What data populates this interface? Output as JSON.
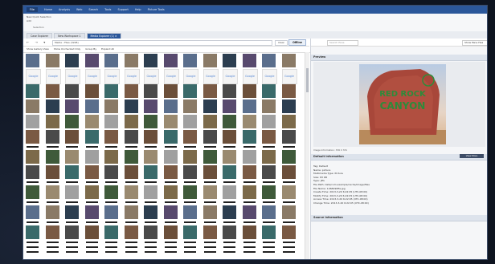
{
  "menubar": {
    "file": "File",
    "items": [
      "Home",
      "Analysis",
      "Web",
      "Search",
      "Tools",
      "Support",
      "Help",
      "Picture Tools"
    ]
  },
  "ribbon": {
    "row1": "New Quick Selection",
    "row2": "Add",
    "row3": "Selection"
  },
  "tabs": [
    {
      "label": "Case Explorer",
      "active": false
    },
    {
      "label": "New Workspace 1",
      "active": false
    },
    {
      "label": "Media Explorer (1) ×",
      "active": true
    }
  ],
  "address": {
    "nav": "← → ▾",
    "path": "Media › Files (3228)",
    "clear": "Clear",
    "offline": "Offline"
  },
  "toolbar": {
    "items": [
      "Show Gallery View",
      "Show Unchecked Only",
      "Group By",
      "Expand All"
    ]
  },
  "grid": {
    "google_label": "Google",
    "row_kinds": [
      "photo",
      "google",
      "photo",
      "photo",
      "photo",
      "photo",
      "label",
      "photo",
      "photo",
      "label",
      "photo",
      "label",
      "photo",
      "label",
      "photo",
      "label",
      "label",
      "label"
    ]
  },
  "right": {
    "search_placeholder": "Search Pane",
    "view_option": "Show Pane Hea",
    "preview_header": "Preview",
    "photo_text": {
      "line1": "RED ROCK",
      "line2": "CANYON"
    },
    "image_info": "Image Information: 336 X 331",
    "details_header": "Default Information",
    "more_button": "View More",
    "details": [
      "Tag: Default",
      "Name: picture",
      "Multimedia Type: Picture",
      "Size: 83 KB",
      "Type: JPG",
      "File Path: data/com.example/cache/image/files",
      "File Name: 1268490ffe.jpg",
      "Create Time: 2013-3-20 6:22:05 (UTC-08:00)",
      "Modify Time: 2013-3-20 6:22:05 (UTC-08:00)",
      "Access Time: 2013-3-20 6:22:05 (UTC-08:00)",
      "Change Time: 2013-3-20 6:22:05 (UTC-08:00)"
    ],
    "source_header": "Source Information"
  }
}
